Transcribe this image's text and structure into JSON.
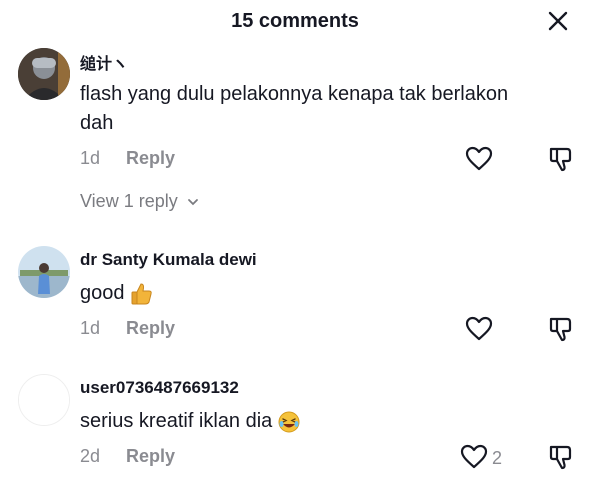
{
  "header": {
    "title": "15 comments",
    "close_icon": "close-icon"
  },
  "comments": [
    {
      "username": "缒计ヽ",
      "text_line1": "flash yang dulu pelakonnya kenapa tak berlakon",
      "text_line2": "dah",
      "time": "1d",
      "reply_label": "Reply",
      "view_replies": "View 1 reply"
    },
    {
      "username": "dr Santy Kumala dewi",
      "text": "good",
      "emoji_icon": "thumbs-up-icon",
      "time": "1d",
      "reply_label": "Reply"
    },
    {
      "username": "user0736487669132",
      "text": "serius kreatif iklan dia",
      "emoji_icon": "laughing-face-icon",
      "time": "2d",
      "reply_label": "Reply",
      "like_count": "2"
    }
  ],
  "colors": {
    "text": "#161823",
    "muted": "#8a8b91"
  }
}
